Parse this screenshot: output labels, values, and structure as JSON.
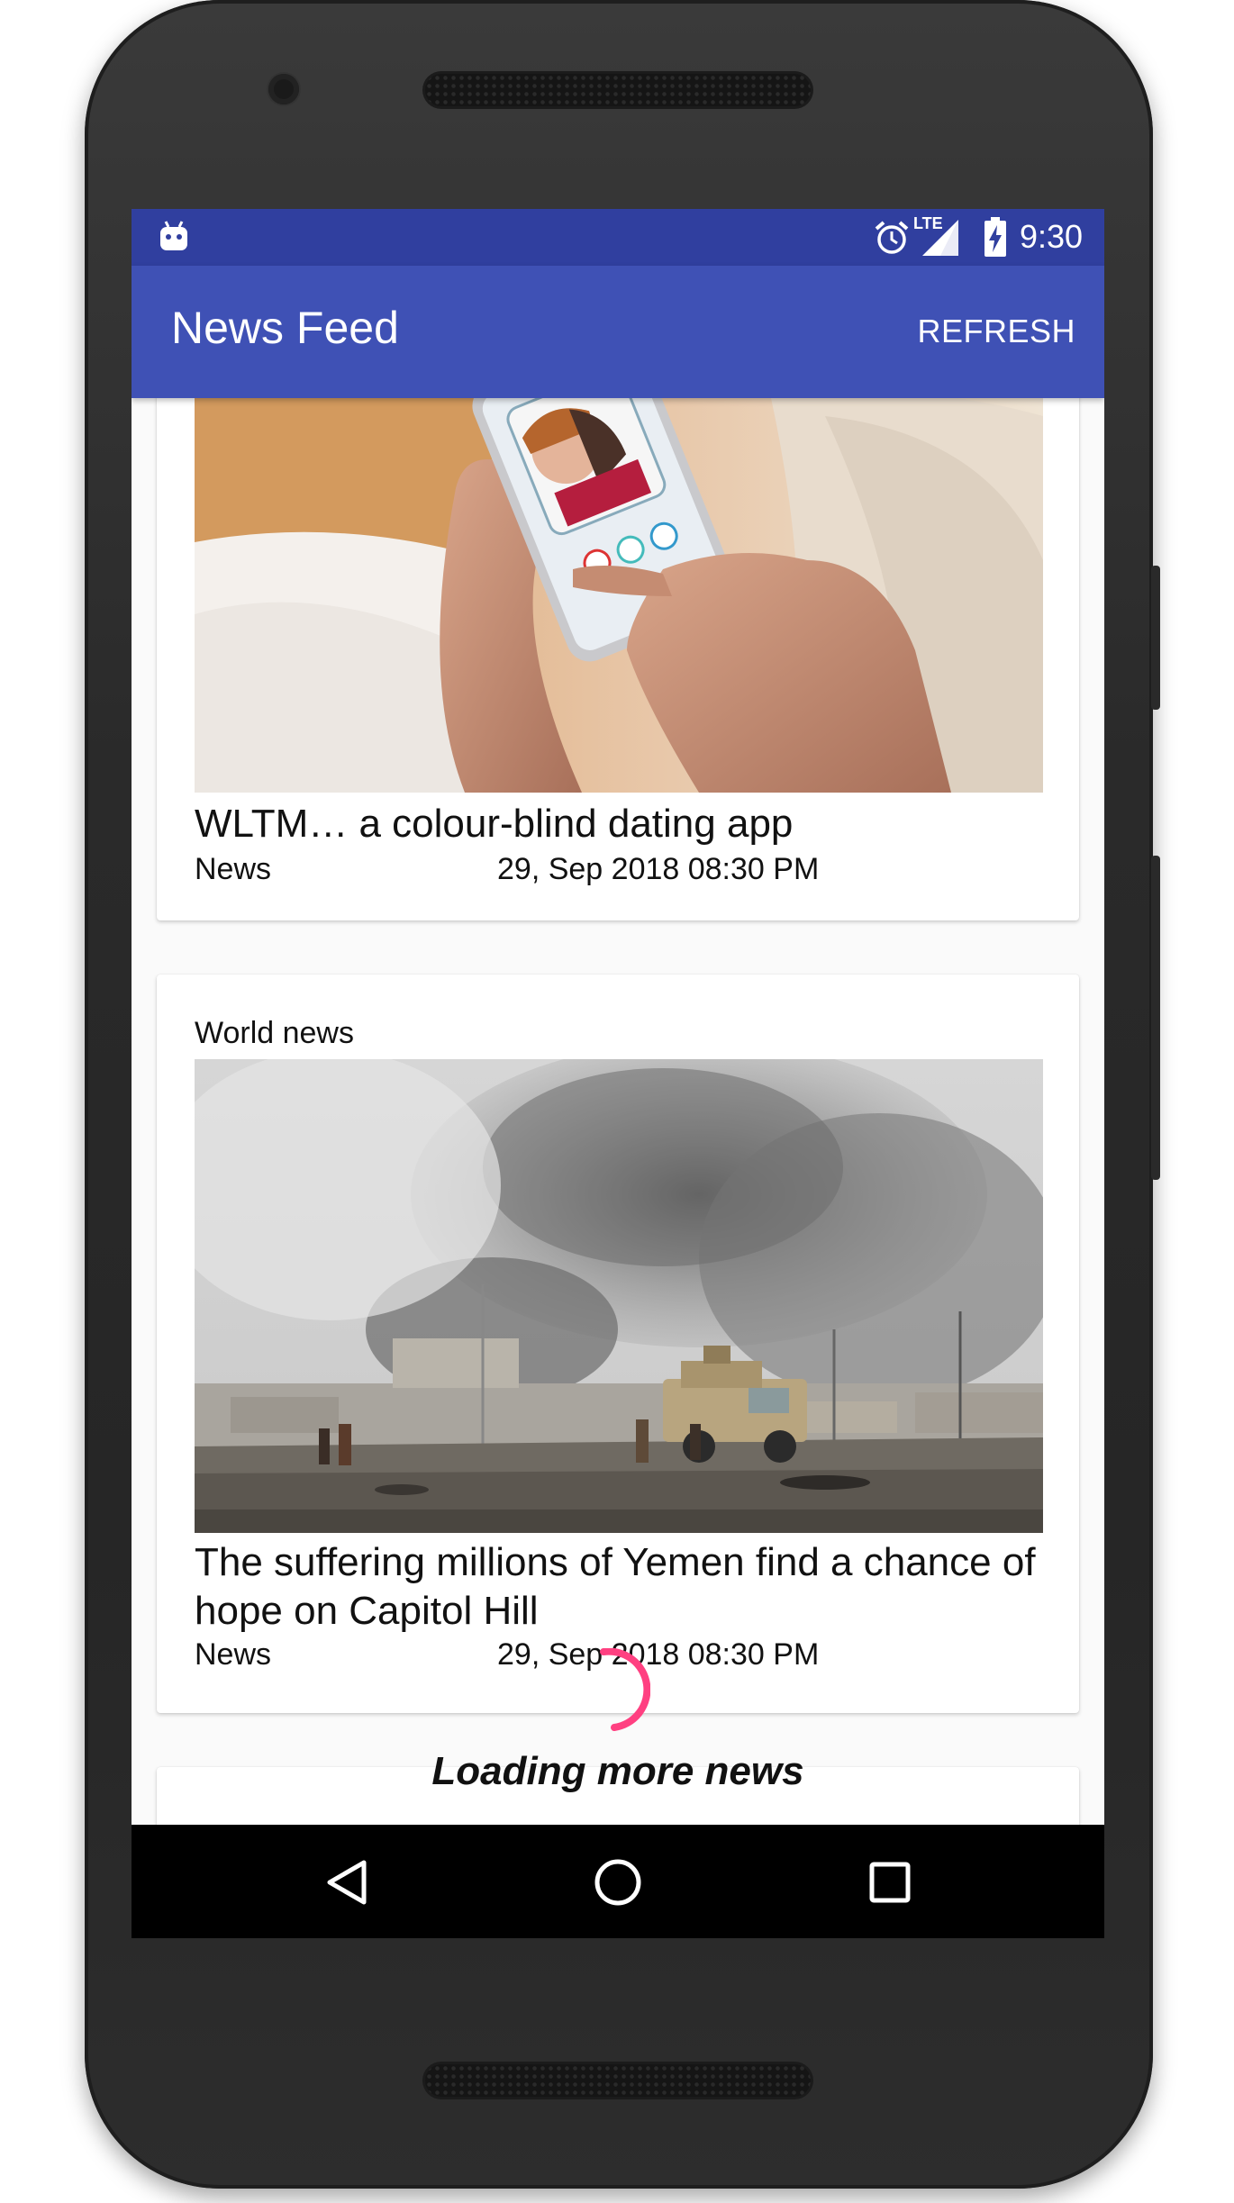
{
  "status_bar": {
    "time": "9:30",
    "network": "LTE",
    "icons": [
      "android-debug-icon",
      "alarm-icon",
      "lte-signal-icon",
      "battery-charging-icon"
    ]
  },
  "app_bar": {
    "title": "News Feed",
    "refresh_label": "REFRESH"
  },
  "articles": [
    {
      "section": "",
      "title": "WLTM… a colour-blind dating app",
      "category": "News",
      "date": "29, Sep 2018 08:30 PM",
      "image": "hands-holding-phone-photo"
    },
    {
      "section": "World news",
      "title": "The suffering millions of Yemen find a chance of hope on Capitol Hill",
      "category": "News",
      "date": "29, Sep 2018 08:30 PM",
      "image": "smoke-over-road-with-armored-vehicle-photo"
    }
  ],
  "loading": {
    "text": "Loading more news",
    "spinner_color": "#ff4081"
  },
  "nav_bar": {
    "icons": [
      "back-icon",
      "home-icon",
      "recents-icon"
    ]
  },
  "colors": {
    "primary": "#3f51b5",
    "primary_dark": "#303f9f",
    "accent": "#ff4081"
  }
}
